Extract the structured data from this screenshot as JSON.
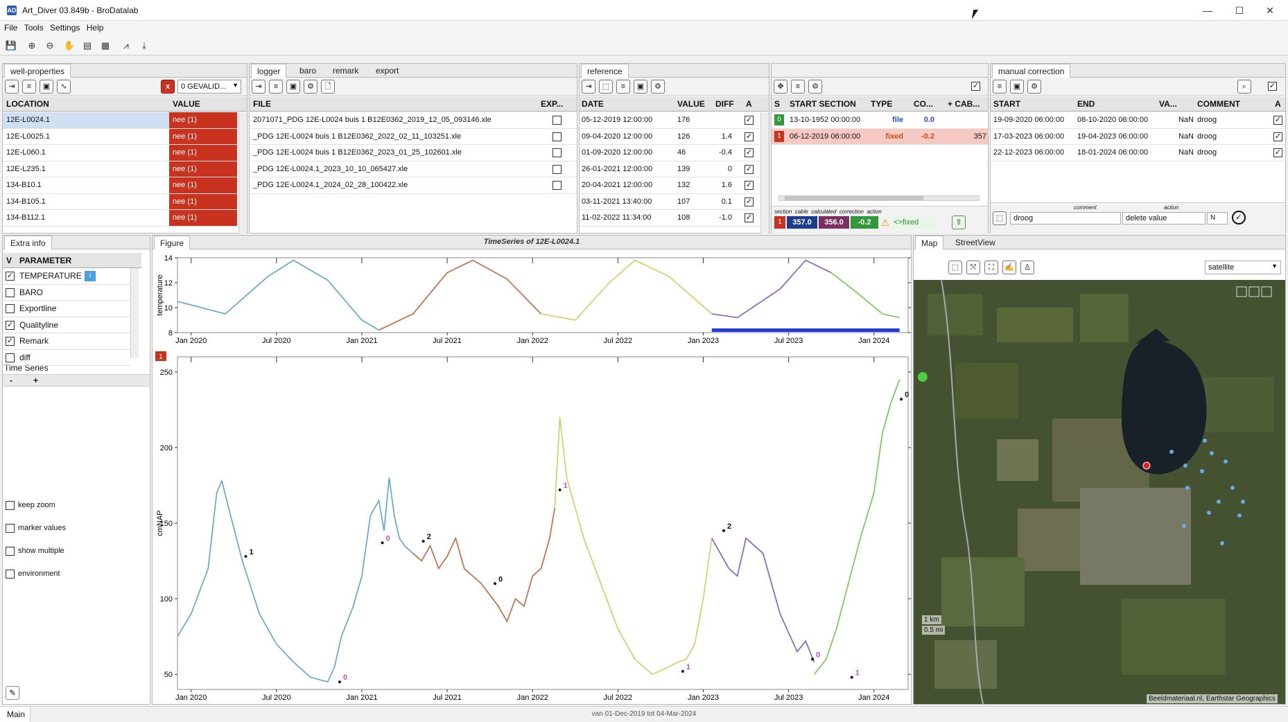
{
  "window": {
    "title": "Art_Diver 03.849b - BroDatalab",
    "app_icon": "AD",
    "minimize": "—",
    "maximize": "☐",
    "close": "✕"
  },
  "menu": [
    "File",
    "Tools",
    "Settings",
    "Help"
  ],
  "toolbar_icons": [
    "save-icon",
    "zoom-in-icon",
    "zoom-out-icon",
    "pan-hand-icon",
    "document-icon",
    "grid-icon",
    "chart-icon",
    "export-icon"
  ],
  "well": {
    "tab": "well-properties",
    "filter": "0 GEVALID...",
    "close_x": "x",
    "col_location": "LOCATION",
    "col_value": "VALUE",
    "rows": [
      {
        "location": "12E-L0024.1",
        "value": "nee (1)"
      },
      {
        "location": "12E-L0025.1",
        "value": "nee (1)"
      },
      {
        "location": "12E-L060.1",
        "value": "nee (1)"
      },
      {
        "location": "12E-L235.1",
        "value": "nee (1)"
      },
      {
        "location": "134-B10.1",
        "value": "nee (1)"
      },
      {
        "location": "134-B105.1",
        "value": "nee (1)"
      },
      {
        "location": "134-B112.1",
        "value": "nee (1)"
      }
    ]
  },
  "logger": {
    "tabs": [
      "logger",
      "baro",
      "remark",
      "export"
    ],
    "col_file": "FILE",
    "col_exp": "EXP...",
    "files": [
      "2071071_PDG 12E-L0024 buis 1 B12E0362_2019_12_05_093146.xle",
      "_PDG 12E-L0024 buis 1 B12E0362_2022_02_11_103251.xle",
      "_PDG 12E-L0024 buis 1 B12E0362_2023_01_25_102601.xle",
      "_PDG 12E-L0024.1_2023_10_10_065427.xle",
      "_PDG 12E-L0024.1_2024_02_28_100422.xle"
    ]
  },
  "reference": {
    "tab": "reference",
    "cols": [
      "DATE",
      "VALUE",
      "DIFF",
      "A"
    ],
    "rows": [
      {
        "date": "05-12-2019 12:00:00",
        "value": "176",
        "diff": ""
      },
      {
        "date": "09-04-2020 12:00:00",
        "value": "126",
        "diff": "1.4"
      },
      {
        "date": "01-09-2020 12:00:00",
        "value": "46",
        "diff": "-0.4"
      },
      {
        "date": "26-01-2021 12:00:00",
        "value": "139",
        "diff": "0"
      },
      {
        "date": "20-04-2021 12:00:00",
        "value": "132",
        "diff": "1.6"
      },
      {
        "date": "03-11-2021 13:40:00",
        "value": "107",
        "diff": "0.1"
      },
      {
        "date": "11-02-2022 11:34:00",
        "value": "108",
        "diff": "-1.0"
      }
    ]
  },
  "sections": {
    "cols": [
      "S",
      "START SECTION",
      "TYPE",
      "CO...",
      "+ CAB..."
    ],
    "rows": [
      {
        "s": "0",
        "start": "13-10-1952 00:00:00",
        "type": "file",
        "co": "0.0",
        "cab": ""
      },
      {
        "s": "1",
        "start": "06-12-2019 06:00:00",
        "type": "fixed",
        "co": "-0.2",
        "cab": "357"
      }
    ],
    "footer_labels": [
      "section",
      "cable",
      "calculated",
      "correction",
      "action"
    ],
    "footer_values": {
      "section": "1",
      "cable": "357.0",
      "calculated": "356.0",
      "correction": "-0.2",
      "action": "<>fixed"
    }
  },
  "manual": {
    "tab": "manual correction",
    "cols": [
      "START",
      "END",
      "VA...",
      "COMMENT",
      "A"
    ],
    "rows": [
      {
        "start": "19-09-2020 06:00:00",
        "end": "08-10-2020 06:00:00",
        "va": "NaN",
        "comment": "droog"
      },
      {
        "start": "17-03-2023 06:00:00",
        "end": "19-04-2023 06:00:00",
        "va": "NaN",
        "comment": "droog"
      },
      {
        "start": "22-12-2023 06:00:00",
        "end": "18-01-2024 06:00:00",
        "va": "NaN",
        "comment": "droog"
      }
    ],
    "footer_labels": [
      "comment",
      "action"
    ],
    "footer_comment": "droog",
    "footer_action": "delete value",
    "footer_n": "N"
  },
  "extra": {
    "tab": "Extra info",
    "col_v": "V",
    "col_param": "PARAMETER",
    "params": [
      {
        "name": "TEMPERATURE",
        "checked": true
      },
      {
        "name": "BARO",
        "checked": false
      },
      {
        "name": "Exportline",
        "checked": false
      },
      {
        "name": "Qualityline",
        "checked": true
      },
      {
        "name": "Remark",
        "checked": true
      },
      {
        "name": "diff",
        "checked": false
      }
    ],
    "timeseries": "Time Series",
    "minus": "-",
    "plus": "+",
    "options": [
      "keep zoom",
      "marker values",
      "show multiple",
      "environment"
    ]
  },
  "figure": {
    "tab": "Figure",
    "title": "TimeSeries of 12E-L0024.1",
    "top_ylabel": "temperature",
    "main_ylabel": "cmNAP",
    "section_badge": "1"
  },
  "map": {
    "tabs": [
      "Map",
      "StreetView"
    ],
    "layer": "satellite",
    "scale1": "1 km",
    "scale2": "0.5 mi",
    "attribution": "Beeldmateriaal.nl, Earthstar Geographics"
  },
  "status": {
    "tab": "Main",
    "range": "van 01-Dec-2019 tot 04-Mar-2024"
  },
  "chart_data": [
    {
      "type": "line",
      "name": "temperature",
      "ylabel": "temperature",
      "ylim": [
        8,
        14
      ],
      "yticks": [
        8,
        10,
        12,
        14
      ],
      "xticks": [
        "Jan 2020",
        "Jul 2020",
        "Jan 2021",
        "Jul 2021",
        "Jan 2022",
        "Jul 2022",
        "Jan 2023",
        "Jul 2023",
        "Jan 2024"
      ],
      "series": [
        {
          "color": "#5aa2dc",
          "x": [
            2019.92,
            2020.2,
            2020.45,
            2020.6,
            2020.8,
            2021.0,
            2021.1
          ],
          "y": [
            10.5,
            9.5,
            12.5,
            13.8,
            12.2,
            9.0,
            8.2
          ]
        },
        {
          "color": "#c8643c",
          "x": [
            2021.1,
            2021.3,
            2021.5,
            2021.65,
            2021.85,
            2022.05
          ],
          "y": [
            8.2,
            9.5,
            12.8,
            13.8,
            12.3,
            9.5
          ]
        },
        {
          "color": "#d9c95c",
          "x": [
            2022.05,
            2022.25,
            2022.45,
            2022.6,
            2022.8,
            2023.05
          ],
          "y": [
            9.5,
            9.0,
            12.0,
            13.8,
            12.5,
            9.5
          ]
        },
        {
          "color": "#7b5cd6",
          "x": [
            2023.05,
            2023.2,
            2023.45,
            2023.6,
            2023.75
          ],
          "y": [
            9.5,
            9.2,
            11.5,
            13.8,
            12.8
          ]
        },
        {
          "color": "#6bcc4a",
          "x": [
            2023.75,
            2023.9,
            2024.05,
            2024.15
          ],
          "y": [
            12.8,
            11.2,
            9.5,
            9.2
          ]
        }
      ],
      "selection": [
        2023.05,
        2024.15
      ]
    },
    {
      "type": "line",
      "name": "cmNAP",
      "ylabel": "cmNAP",
      "ylim": [
        40,
        260
      ],
      "yticks": [
        50,
        100,
        150,
        200,
        250
      ],
      "xticks": [
        "Jan 2020",
        "Jul 2020",
        "Jan 2021",
        "Jul 2021",
        "Jan 2022",
        "Jul 2022",
        "Jan 2023",
        "Jul 2023",
        "Jan 2024"
      ],
      "series": [
        {
          "color": "#5aa2dc",
          "x": [
            2019.92,
            2020.0,
            2020.1,
            2020.15,
            2020.18,
            2020.22,
            2020.3,
            2020.4,
            2020.5,
            2020.6,
            2020.7,
            2020.8,
            2020.84,
            2020.88,
            2020.95,
            2021.0,
            2021.05,
            2021.1,
            2021.13,
            2021.16,
            2021.19,
            2021.22,
            2021.25,
            2021.3
          ],
          "y": [
            75,
            90,
            120,
            170,
            178,
            160,
            125,
            90,
            70,
            58,
            48,
            45,
            55,
            75,
            95,
            115,
            155,
            165,
            145,
            180,
            155,
            140,
            135,
            130
          ]
        },
        {
          "color": "#c8643c",
          "x": [
            2021.3,
            2021.35,
            2021.4,
            2021.45,
            2021.5,
            2021.55,
            2021.6,
            2021.7,
            2021.8,
            2021.85,
            2021.9,
            2021.95,
            2022.0,
            2022.05,
            2022.1,
            2022.13
          ],
          "y": [
            130,
            125,
            135,
            120,
            128,
            140,
            120,
            110,
            95,
            85,
            100,
            95,
            115,
            120,
            140,
            160
          ]
        },
        {
          "color": "#d9c95c",
          "x": [
            2022.13,
            2022.16,
            2022.2,
            2022.25,
            2022.3,
            2022.4,
            2022.5,
            2022.6,
            2022.7,
            2022.8,
            2022.85,
            2022.9,
            2022.95,
            2023.0,
            2023.05
          ],
          "y": [
            160,
            220,
            180,
            160,
            140,
            110,
            80,
            60,
            50,
            55,
            58,
            60,
            70,
            100,
            140
          ]
        },
        {
          "color": "#7b5cd6",
          "x": [
            2023.05,
            2023.1,
            2023.15,
            2023.2,
            2023.25,
            2023.35,
            2023.4,
            2023.45,
            2023.55,
            2023.6,
            2023.65
          ],
          "y": [
            140,
            130,
            120,
            115,
            140,
            130,
            110,
            90,
            65,
            72,
            58
          ]
        },
        {
          "color": "#6bcc4a",
          "x": [
            2023.65,
            2023.72,
            2023.78,
            2023.85,
            2023.92,
            2024.0,
            2024.05,
            2024.1,
            2024.15
          ],
          "y": [
            50,
            60,
            80,
            110,
            140,
            170,
            210,
            230,
            245
          ]
        }
      ],
      "markers": [
        {
          "x": 2020.32,
          "y": 128,
          "label": "1",
          "color": "#111"
        },
        {
          "x": 2020.87,
          "y": 45,
          "label": "0",
          "color": "#c050d0"
        },
        {
          "x": 2021.12,
          "y": 137,
          "label": "0",
          "color": "#c050d0"
        },
        {
          "x": 2021.36,
          "y": 138,
          "label": "2",
          "color": "#111"
        },
        {
          "x": 2021.78,
          "y": 110,
          "label": "0",
          "color": "#111"
        },
        {
          "x": 2022.16,
          "y": 172,
          "label": "1",
          "color": "#c050d0"
        },
        {
          "x": 2022.88,
          "y": 52,
          "label": "1",
          "color": "#c050d0"
        },
        {
          "x": 2023.12,
          "y": 145,
          "label": "2",
          "color": "#111"
        },
        {
          "x": 2023.64,
          "y": 60,
          "label": "0",
          "color": "#c050d0"
        },
        {
          "x": 2023.87,
          "y": 48,
          "label": "1",
          "color": "#c050d0"
        },
        {
          "x": 2024.16,
          "y": 232,
          "label": "0",
          "color": "#111"
        }
      ]
    }
  ]
}
